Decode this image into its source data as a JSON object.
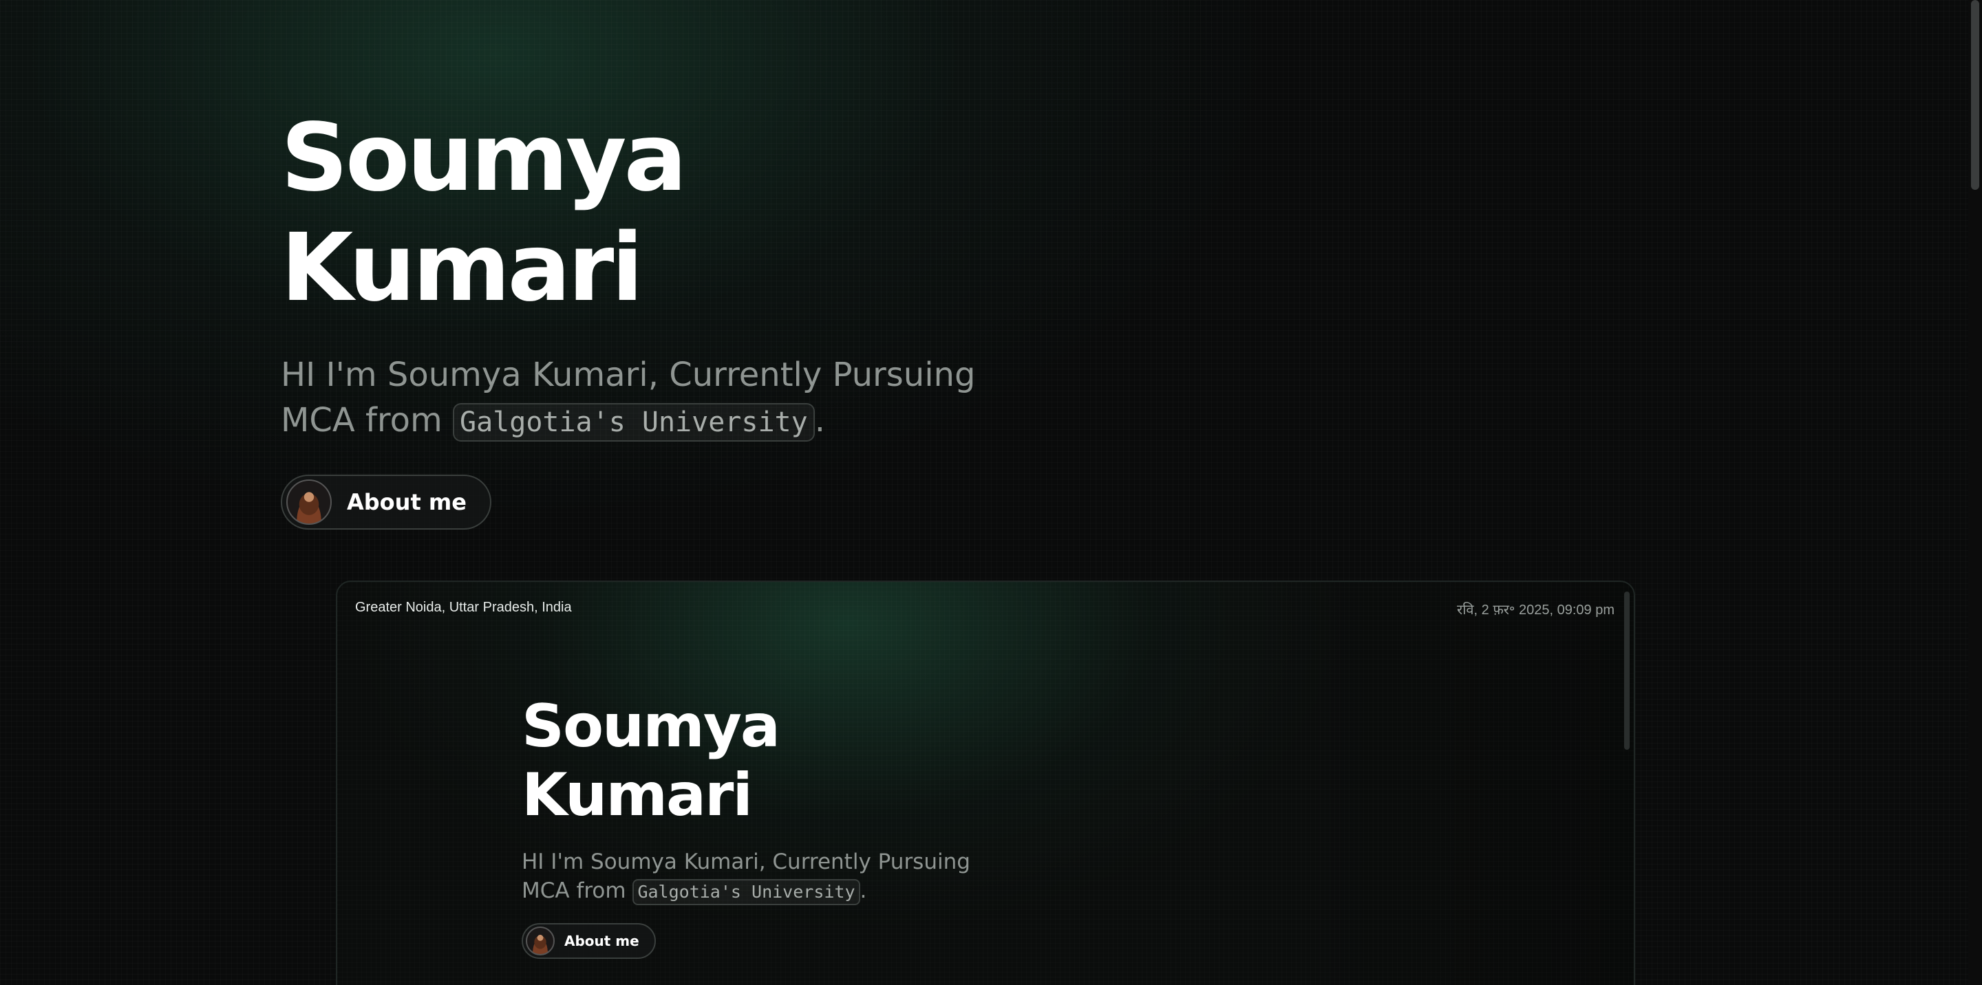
{
  "hero": {
    "title": "Soumya Kumari",
    "description_prefix": "HI I'm Soumya Kumari, Currently Pursuing MCA from ",
    "university": "Galgotia's University",
    "description_suffix": ".",
    "about_label": "About me"
  },
  "preview": {
    "location": "Greater Noida, Uttar Pradesh, India",
    "datetime": "रवि, 2 फ़र॰ 2025, 09:09 pm",
    "title": "Soumya Kumari",
    "description_prefix": "HI I'm Soumya Kumari, Currently Pursuing MCA from ",
    "university": "Galgotia's University",
    "description_suffix": ".",
    "about_label": "About me"
  },
  "colors": {
    "background": "#0a0b0b",
    "accent_glow": "#1e4e3a",
    "muted_text": "#8f9592"
  }
}
